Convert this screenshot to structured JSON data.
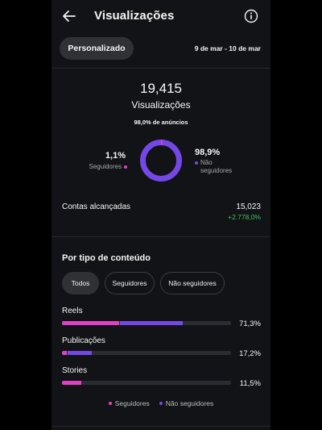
{
  "header": {
    "title": "Visualizações"
  },
  "range": {
    "chip_label": "Personalizado",
    "dates": "9 de mar - 10 de mar"
  },
  "summary": {
    "total": "19,415",
    "label": "Visualizações",
    "ads_note": "98,0% de anúncios",
    "followers_pct": "1,1%",
    "followers_label": "Seguidores",
    "non_followers_pct": "98,9%",
    "non_followers_label_1": "Não",
    "non_followers_label_2": "seguidores",
    "followers_fraction": 0.011
  },
  "reach": {
    "label": "Contas alcançadas",
    "value": "15,023",
    "delta": "+2.778,0%"
  },
  "content_type": {
    "title": "Por tipo de conteúdo",
    "filters": [
      "Todos",
      "Seguidores",
      "Não seguidores"
    ],
    "active_filter": 0,
    "rows": [
      {
        "label": "Reels",
        "pct": "71,3%",
        "followers": 0.34,
        "non_followers": 0.37
      },
      {
        "label": "Publicações",
        "pct": "17,2%",
        "followers": 0.03,
        "non_followers": 0.14
      },
      {
        "label": "Stories",
        "pct": "11,5%",
        "followers": 0.115,
        "non_followers": 0.0
      }
    ],
    "legend": {
      "followers": "Seguidores",
      "non_followers": "Não seguidores"
    }
  },
  "colors": {
    "followers": "#e040c8",
    "non_followers": "#7448e6",
    "positive": "#4cbe62"
  }
}
